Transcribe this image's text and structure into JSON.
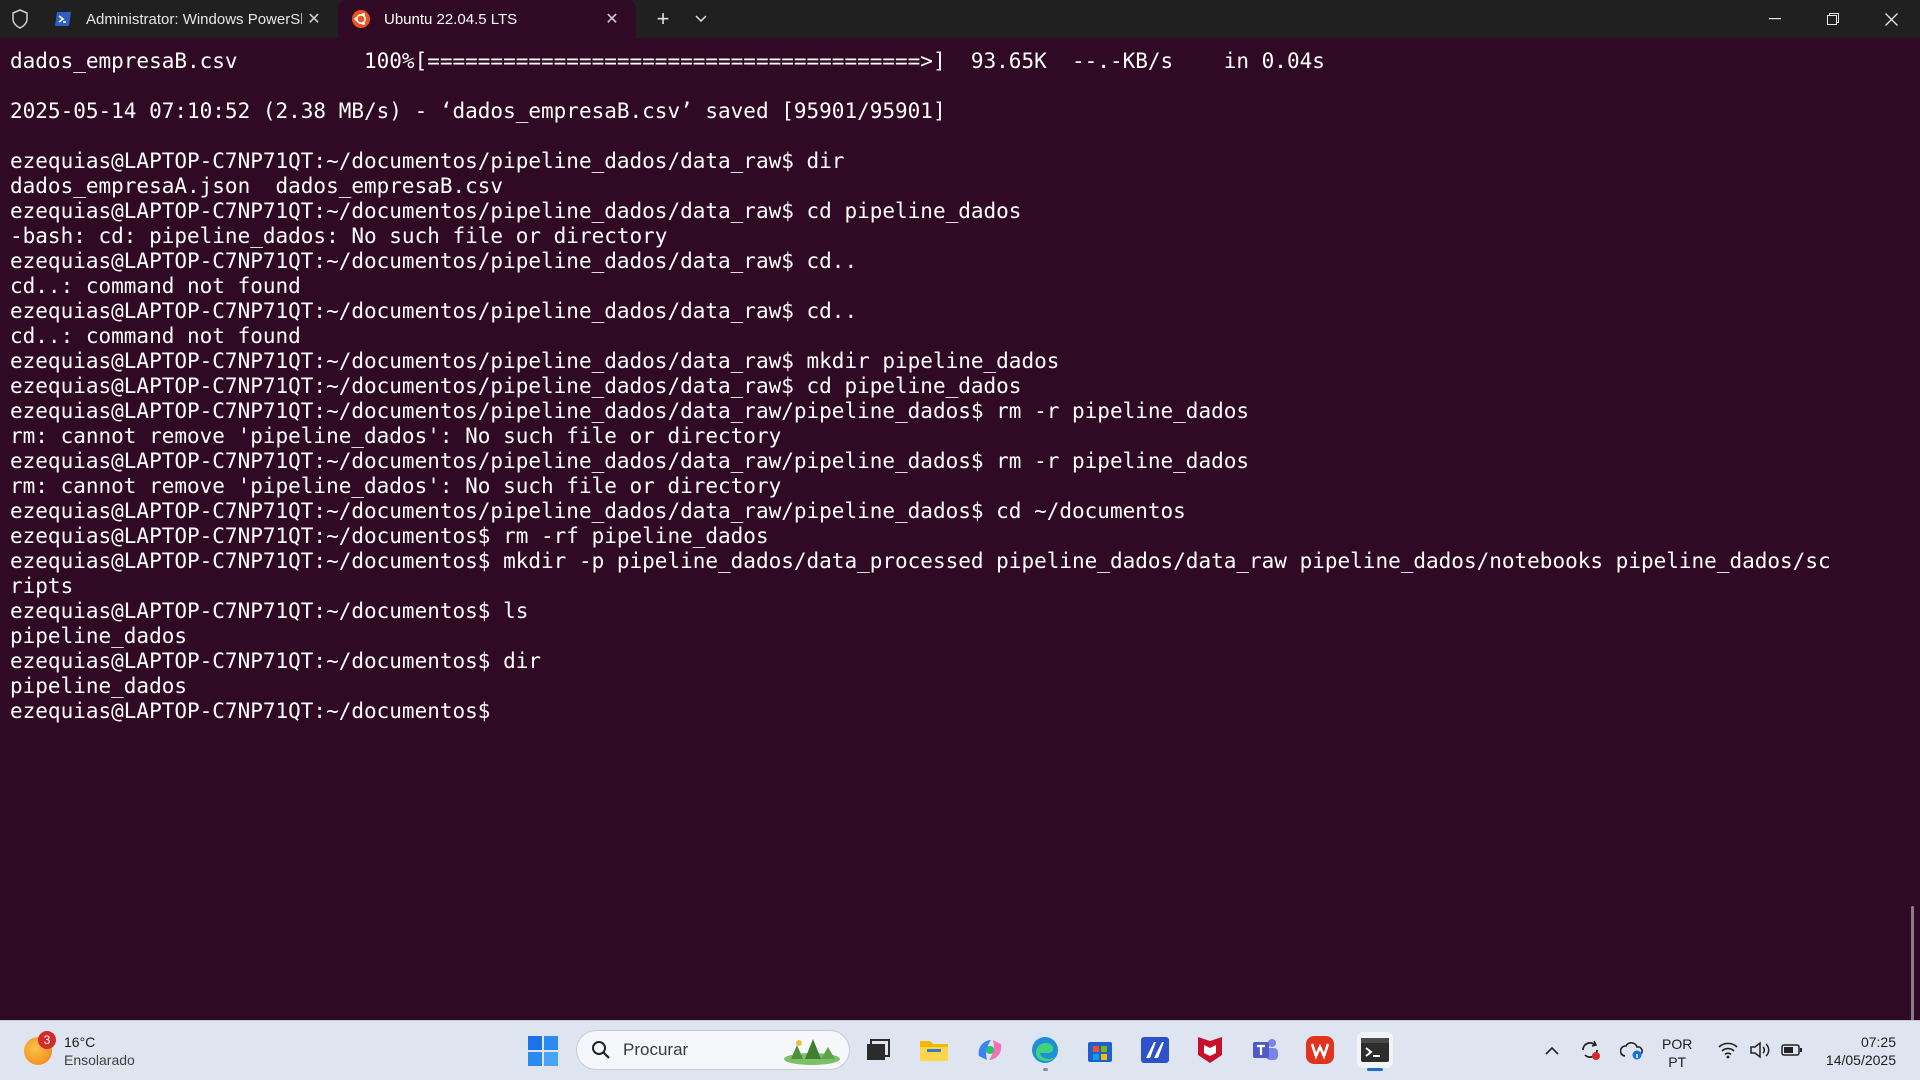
{
  "titlebar": {
    "tabs": [
      {
        "title": "Administrator: Windows PowerShell",
        "icon": "powershell-icon",
        "active": false
      },
      {
        "title": "Ubuntu 22.04.5 LTS",
        "icon": "ubuntu-icon",
        "active": true
      }
    ],
    "new_tab_icon": "plus-icon",
    "dropdown_icon": "chevron-down-icon",
    "window_controls": [
      "minimize-icon",
      "restore-icon",
      "close-icon"
    ]
  },
  "terminal": {
    "background": "#300a24",
    "foreground": "#ffffff",
    "lines": [
      "dados_empresaB.csv          100%[=======================================>]  93.65K  --.-KB/s    in 0.04s",
      "",
      "2025-05-14 07:10:52 (2.38 MB/s) - ‘dados_empresaB.csv’ saved [95901/95901]",
      "",
      "ezequias@LAPTOP-C7NP71QT:~/documentos/pipeline_dados/data_raw$ dir",
      "dados_empresaA.json  dados_empresaB.csv",
      "ezequias@LAPTOP-C7NP71QT:~/documentos/pipeline_dados/data_raw$ cd pipeline_dados",
      "-bash: cd: pipeline_dados: No such file or directory",
      "ezequias@LAPTOP-C7NP71QT:~/documentos/pipeline_dados/data_raw$ cd..",
      "cd..: command not found",
      "ezequias@LAPTOP-C7NP71QT:~/documentos/pipeline_dados/data_raw$ cd..",
      "cd..: command not found",
      "ezequias@LAPTOP-C7NP71QT:~/documentos/pipeline_dados/data_raw$ mkdir pipeline_dados",
      "ezequias@LAPTOP-C7NP71QT:~/documentos/pipeline_dados/data_raw$ cd pipeline_dados",
      "ezequias@LAPTOP-C7NP71QT:~/documentos/pipeline_dados/data_raw/pipeline_dados$ rm -r pipeline_dados",
      "rm: cannot remove 'pipeline_dados': No such file or directory",
      "ezequias@LAPTOP-C7NP71QT:~/documentos/pipeline_dados/data_raw/pipeline_dados$ rm -r pipeline_dados",
      "rm: cannot remove 'pipeline_dados': No such file or directory",
      "ezequias@LAPTOP-C7NP71QT:~/documentos/pipeline_dados/data_raw/pipeline_dados$ cd ~/documentos",
      "ezequias@LAPTOP-C7NP71QT:~/documentos$ rm -rf pipeline_dados",
      "ezequias@LAPTOP-C7NP71QT:~/documentos$ mkdir -p pipeline_dados/data_processed pipeline_dados/data_raw pipeline_dados/notebooks pipeline_dados/sc",
      "ripts",
      "ezequias@LAPTOP-C7NP71QT:~/documentos$ ls",
      "pipeline_dados",
      "ezequias@LAPTOP-C7NP71QT:~/documentos$ dir",
      "pipeline_dados",
      "ezequias@LAPTOP-C7NP71QT:~/documentos$ "
    ]
  },
  "taskbar": {
    "weather": {
      "temp": "16°C",
      "condition": "Ensolarado",
      "badge": "3"
    },
    "search_placeholder": "Procurar",
    "apps": [
      "task-view-icon",
      "file-explorer-icon",
      "copilot-icon",
      "edge-icon",
      "store-icon",
      "vscode-like-icon",
      "mcafee-icon",
      "teams-icon",
      "wps-office-icon",
      "terminal-icon"
    ],
    "language": {
      "line1": "POR",
      "line2": "PT"
    },
    "clock": {
      "time": "07:25",
      "date": "14/05/2025"
    }
  }
}
